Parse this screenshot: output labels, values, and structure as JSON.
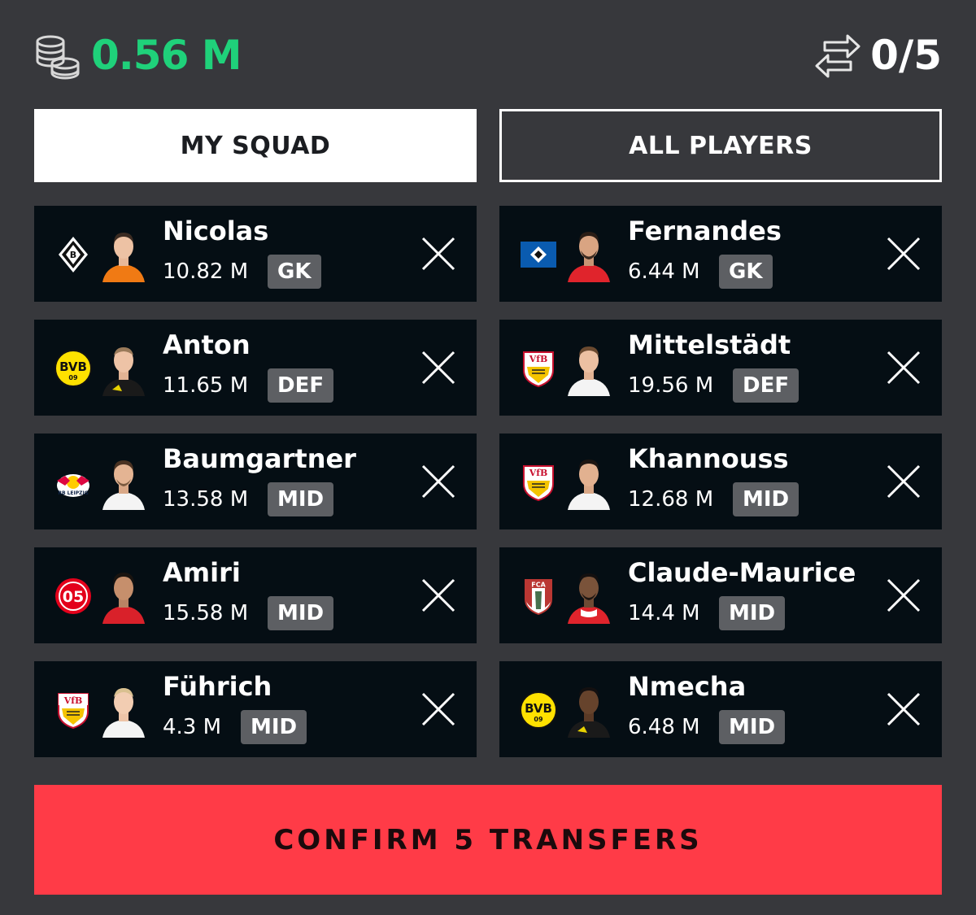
{
  "header": {
    "budget": "0.56 M",
    "transfers": "0/5",
    "budget_color": "#1fd17a"
  },
  "tabs": [
    {
      "label": "MY SQUAD",
      "active": true
    },
    {
      "label": "ALL PLAYERS",
      "active": false
    }
  ],
  "squad": [
    {
      "name": "Nicolas",
      "price": "10.82 M",
      "position": "GK",
      "club": "Gladbach",
      "kit": "#f07a14"
    },
    {
      "name": "Anton",
      "price": "11.65 M",
      "position": "DEF",
      "club": "Dortmund",
      "kit": "#1a1a1a"
    },
    {
      "name": "Baumgartner",
      "price": "13.58 M",
      "position": "MID",
      "club": "Leipzig",
      "kit": "#ffffff"
    },
    {
      "name": "Amiri",
      "price": "15.58 M",
      "position": "MID",
      "club": "Mainz",
      "kit": "#d9212a"
    },
    {
      "name": "Führich",
      "price": "4.3 M",
      "position": "MID",
      "club": "Stuttgart",
      "kit": "#ffffff"
    }
  ],
  "incoming": [
    {
      "name": "Fernandes",
      "price": "6.44 M",
      "position": "GK",
      "club": "Hamburg",
      "kit": "#e0242c"
    },
    {
      "name": "Mittelstädt",
      "price": "19.56 M",
      "position": "DEF",
      "club": "Stuttgart",
      "kit": "#ffffff"
    },
    {
      "name": "Khannouss",
      "price": "12.68 M",
      "position": "MID",
      "club": "Stuttgart",
      "kit": "#ffffff"
    },
    {
      "name": "Claude-Maurice",
      "price": "14.4 M",
      "position": "MID",
      "club": "Augsburg",
      "kit": "#e0242c"
    },
    {
      "name": "Nmecha",
      "price": "6.48 M",
      "position": "MID",
      "club": "Dortmund",
      "kit": "#1a1a1a"
    }
  ],
  "confirm_label": "CONFIRM 5 TRANSFERS",
  "colors": {
    "background": "#37383c",
    "card": "#050e14",
    "badge": "#5d5f63",
    "confirm": "#ff3b47"
  }
}
